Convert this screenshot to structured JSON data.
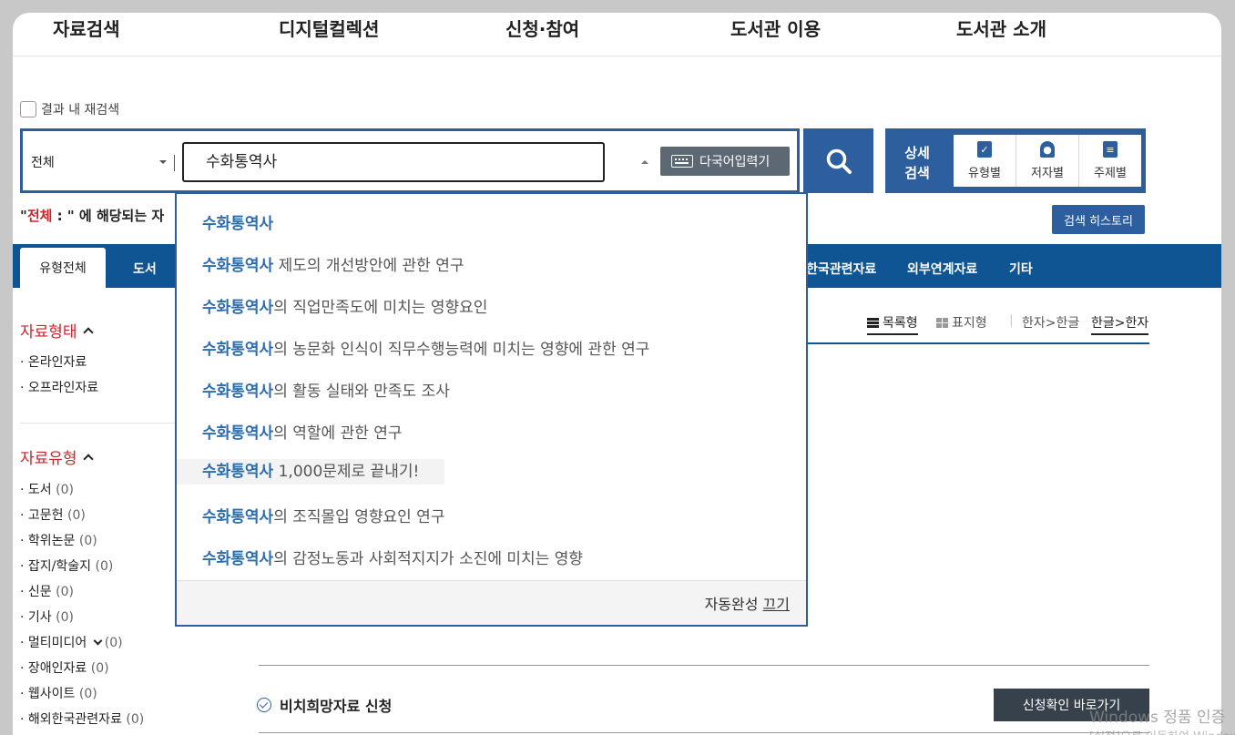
{
  "gnb": {
    "items": [
      "자료검색",
      "디지털컬렉션",
      "신청·참여",
      "도서관 이용",
      "도서관 소개"
    ]
  },
  "search": {
    "research_label": "결과 내 재검색",
    "scope": "전체",
    "query": "수화통역사",
    "keyboard_label": "다국어입력기"
  },
  "advanced": {
    "label_line1": "상세",
    "label_line2": "검색",
    "items": [
      "유형별",
      "저자별",
      "주제별"
    ]
  },
  "result": {
    "open_quote": "\"",
    "scope": "전체",
    "tail": " : \" 에 해당되는 자",
    "history_button": "검색 히스토리"
  },
  "tabs": [
    "유형전체",
    "도서",
    "한국관련자료",
    "외부연계자료",
    "기타"
  ],
  "facets": {
    "form_title": "자료형태",
    "form_items": [
      "온라인자료",
      "오프라인자료"
    ],
    "type_title": "자료유형",
    "type_items": [
      {
        "label": "도서",
        "count": "(0)"
      },
      {
        "label": "고문헌",
        "count": "(0)"
      },
      {
        "label": "학위논문",
        "count": "(0)"
      },
      {
        "label": "잡지/학술지",
        "count": "(0)"
      },
      {
        "label": "신문",
        "count": "(0)"
      },
      {
        "label": "기사",
        "count": "(0)"
      },
      {
        "label": "멀티미디어",
        "count": "(0)"
      },
      {
        "label": "장애인자료",
        "count": "(0)"
      },
      {
        "label": "웹사이트",
        "count": "(0)"
      },
      {
        "label": "해외한국관련자료",
        "count": "(0)"
      }
    ]
  },
  "view": {
    "list": "목록형",
    "cover": "표지형",
    "hanja_to_hangul": "한자>한글",
    "hangul_to_hanja": "한글>한자"
  },
  "autocomplete": {
    "keyword": "수화통역사",
    "suffixes": [
      "",
      " 제도의 개선방안에 관한 연구",
      "의 직업만족도에 미치는 영향요인",
      "의 농문화 인식이 직무수행능력에 미치는 영향에 관한 연구",
      "의 활동 실태와 만족도 조사",
      "의 역할에 관한 연구",
      " 1,000문제로 끝내기!",
      "의 조직몰입 영향요인 연구",
      "의 감정노동과 사회적지지가 소진에 미치는 영향"
    ],
    "off_prefix": "자동완성 ",
    "off_link": "끄기"
  },
  "request": {
    "title": "비치희망자료 신청",
    "button": "신청확인 바로가기"
  },
  "watermark": {
    "line1": "Windows 정품 인증",
    "line2": "[설정]으로 이동하여 Windows를"
  },
  "colors": {
    "primary": "#2d5f9e",
    "tabbar": "#0f5593",
    "accent_red": "#c8252c"
  }
}
